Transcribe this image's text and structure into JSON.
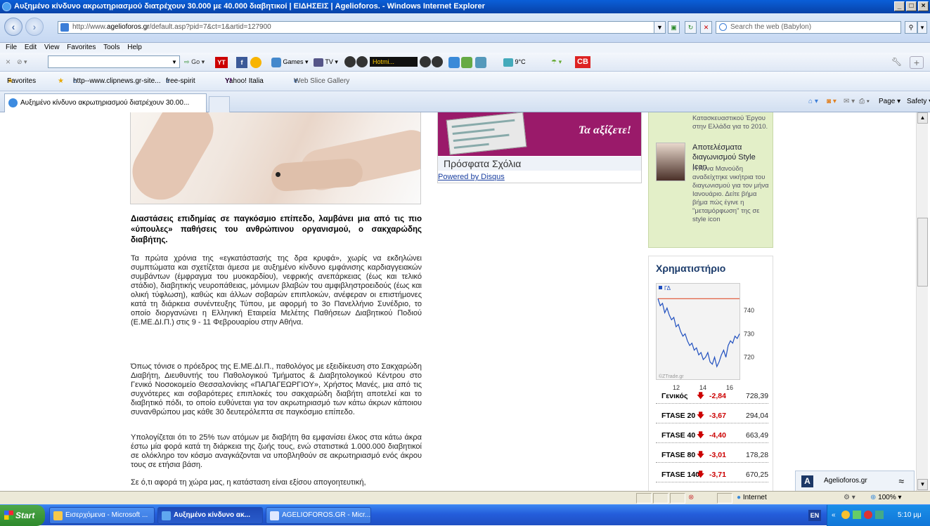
{
  "window": {
    "title": "Αυξημένο κίνδυνο ακρωτηριασμού διατρέχουν 30.000 με 40.000 διαβητικοί | ΕΙΔΗΣΕΙΣ | Agelioforos. - Windows Internet Explorer"
  },
  "address": {
    "url_prefix": "http://www.",
    "url_domain": "agelioforos.gr",
    "url_rest": "/default.asp?pid=7&ct=1&artid=127900",
    "search_placeholder": "Search the web (Babylon)"
  },
  "menu": [
    "File",
    "Edit",
    "View",
    "Favorites",
    "Tools",
    "Help"
  ],
  "toolbar": {
    "go": "Go",
    "games": "Games",
    "tv": "TV",
    "hotmail": "Hotmi...",
    "temp": "9°C",
    "yt": "YT",
    "cb": "CB"
  },
  "favorites": {
    "label": "Favorites",
    "items": [
      "http--www.clipnews.gr-site...",
      "free-spirit",
      "Yahoo! Italia",
      "Web Slice Gallery"
    ]
  },
  "tab": {
    "title": "Αυξημένο κίνδυνο ακρωτηριασμού διατρέχουν 30.00..."
  },
  "commands": {
    "page": "Page",
    "safety": "Safety",
    "tools": "Tools"
  },
  "article": {
    "lead": "Διαστάσεις επιδημίας σε παγκόσμιο επίπεδο, λαμβάνει μια από τις πιο «ύπουλες» παθήσεις του ανθρώπινου οργανισμού, ο σακχαρώδης διαβήτης.",
    "p1": "Τα πρώτα χρόνια της «εγκατάστασής της δρα κρυφά», χωρίς να εκδηλώνει συμπτώματα και σχετίζεται άμεσα με αυξημένο κίνδυνο εμφάνισης καρδιαγγειακών συμβάντων (έμφραγμα του μυοκαρδίου), νεφρικής ανεπάρκειας (έως και τελικό στάδιο), διαβητικής νευροπάθειας, μόνιμων βλαβών του αμφιβληστροειδούς (έως και ολική τύφλωση), καθώς και άλλων σοβαρών επιπλοκών, ανέφεραν οι επιστήμονες κατά τη διάρκεια συνέντευξης Τύπου, με αφορμή το 3ο Πανελλήνιο Συνέδριο, το οποίο διοργανώνει η Ελληνική Εταιρεία Μελέτης Παθήσεων Διαβητικού Ποδιού (Ε.ΜΕ.ΔΙ.Π.) στις 9 - 11 Φεβρουαρίου στην Αθήνα.",
    "p2": "Όπως τόνισε ο πρόεδρος της Ε.ΜΕ.ΔΙ.Π., παθολόγος με εξειδίκευση στο Σακχαρώδη Διαβήτη, Διευθυντής του Παθολογικού Τμήματος & Διαβητολογικού Κέντρου στο Γενικό Νοσοκομείο Θεσσαλονίκης «ΠΑΠΑΓΕΩΡΓΙΟΥ», Χρήστος Μανές, μια από τις συχνότερες και σοβαρότερες επιπλοκές του σακχαρώδη διαβήτη αποτελεί και το διαβητικό πόδι, το οποίο ευθύνεται για τον ακρωτηριασμό των κάτω άκρων κάποιου συνανθρώπου μας κάθε 30 δευτερόλεπτα σε παγκόσμιο επίπεδο.",
    "p3": "Υπολογίζεται ότι το 25% των ατόμων με διαβήτη θα εμφανίσει έλκος στα κάτω άκρα έστω μία φορά κατά τη διάρκεια της ζωής τους, ενώ στατιστικά 1.000.000 διαβητικοί σε ολόκληρο τον κόσμο αναγκάζονται να υποβληθούν σε ακρωτηριασμό ενός άκρου τους σε ετήσια βάση.",
    "p4": "Σε ό,τι αφορά τη χώρα μας, η κατάσταση είναι εξίσου απογοητευτική,"
  },
  "widget": {
    "slogan": "Τα αξίζετε!",
    "recent": "Πρόσφατα Σχόλια",
    "powered": "Powered by Disqus"
  },
  "green": {
    "top1": "Κατασκευαστικού Έργου",
    "top2": "στην Ελλάδα για το 2010.",
    "title": "Αποτελέσματα διαγωνισμού Style Icon",
    "body": "Η Άννα Μανούδη αναδείχτηκε νικήτρια του διαγωνισμού για τον μήνα Ιανουάριο. Δείτε βήμα βήμα πώς έγινε η \"μεταμόρφωση\" της σε style icon"
  },
  "stock": {
    "title": "Χρηματιστήριο",
    "rows": [
      {
        "name": "Γενικός",
        "change": "-2,84",
        "value": "728,39"
      },
      {
        "name": "FTASE 20",
        "change": "-3,67",
        "value": "294,04"
      },
      {
        "name": "FTASE 40",
        "change": "-4,40",
        "value": "663,49"
      },
      {
        "name": "FTASE 80",
        "change": "-3,01",
        "value": "178,28"
      },
      {
        "name": "FTASE 140",
        "change": "-3,71",
        "value": "670,25"
      }
    ]
  },
  "chart_data": {
    "type": "line",
    "legend": "ΓΔ",
    "watermark": "©ZTrade.gr",
    "x_ticks": [
      "12",
      "14",
      "16"
    ],
    "y_ticks": [
      "740",
      "730",
      "720"
    ],
    "ylim": [
      713,
      749
    ],
    "reference_line": 745,
    "series": [
      {
        "values": [
          745,
          742,
          743,
          739,
          741,
          738,
          736,
          737,
          733,
          734,
          731,
          729,
          730,
          727,
          725,
          726,
          723,
          724,
          721,
          722,
          719,
          720,
          722,
          718,
          717,
          720,
          716,
          718,
          721,
          723,
          720,
          725,
          727,
          726,
          729,
          728,
          730
        ]
      }
    ],
    "colors": {
      "series": "#1f4fbf",
      "reference": "#e05030"
    }
  },
  "toast": {
    "label": "Agelioforos.gr"
  },
  "status": {
    "zone": "Internet",
    "zoom": "100%"
  },
  "taskbar": {
    "start": "Start",
    "items": [
      "Εισερχόμενα - Microsoft ...",
      "Αυξημένο κίνδυνο ακ...",
      "AGELIOFOROS.GR - Micr..."
    ],
    "lang": "EN",
    "clock": "5:10 μμ"
  }
}
